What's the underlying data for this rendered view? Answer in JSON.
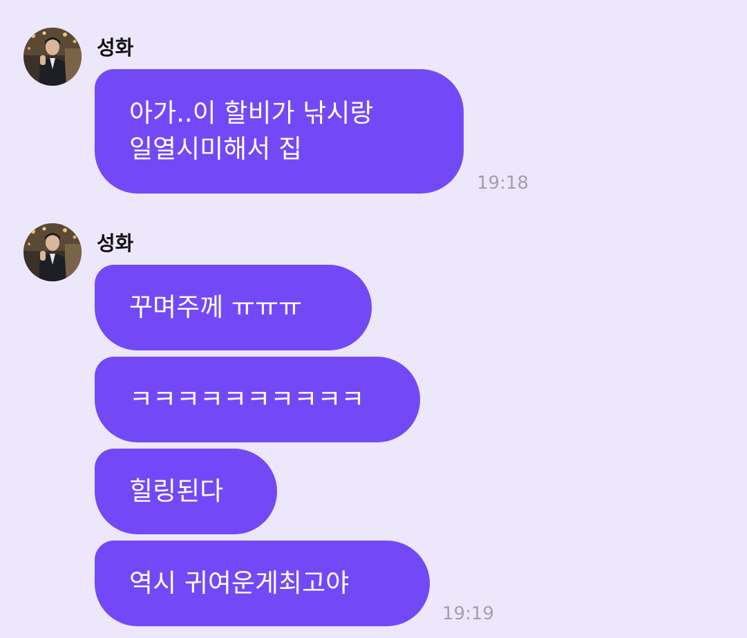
{
  "messages": [
    {
      "sender": "성화",
      "avatar_icon": "profile-photo",
      "bubbles": [
        {
          "lines": [
            "아가..이 할비가 낚시랑",
            "일열시미해서 집"
          ]
        }
      ],
      "time": "19:18"
    },
    {
      "sender": "성화",
      "avatar_icon": "profile-photo",
      "bubbles": [
        {
          "lines": [
            "꾸며주께 ㅠㅠㅠ"
          ]
        },
        {
          "lines": [
            "ㅋㅋㅋㅋㅋㅋㅋㅋㅋㅋ"
          ]
        },
        {
          "lines": [
            "힐링된다"
          ]
        },
        {
          "lines": [
            "역시 귀여운게최고야"
          ]
        }
      ],
      "time": "19:19"
    }
  ],
  "colors": {
    "background": "#ede7fc",
    "bubble": "#7349f7",
    "bubble_text": "#ffffff",
    "time_text": "#a39fae",
    "sender_text": "#111111"
  }
}
